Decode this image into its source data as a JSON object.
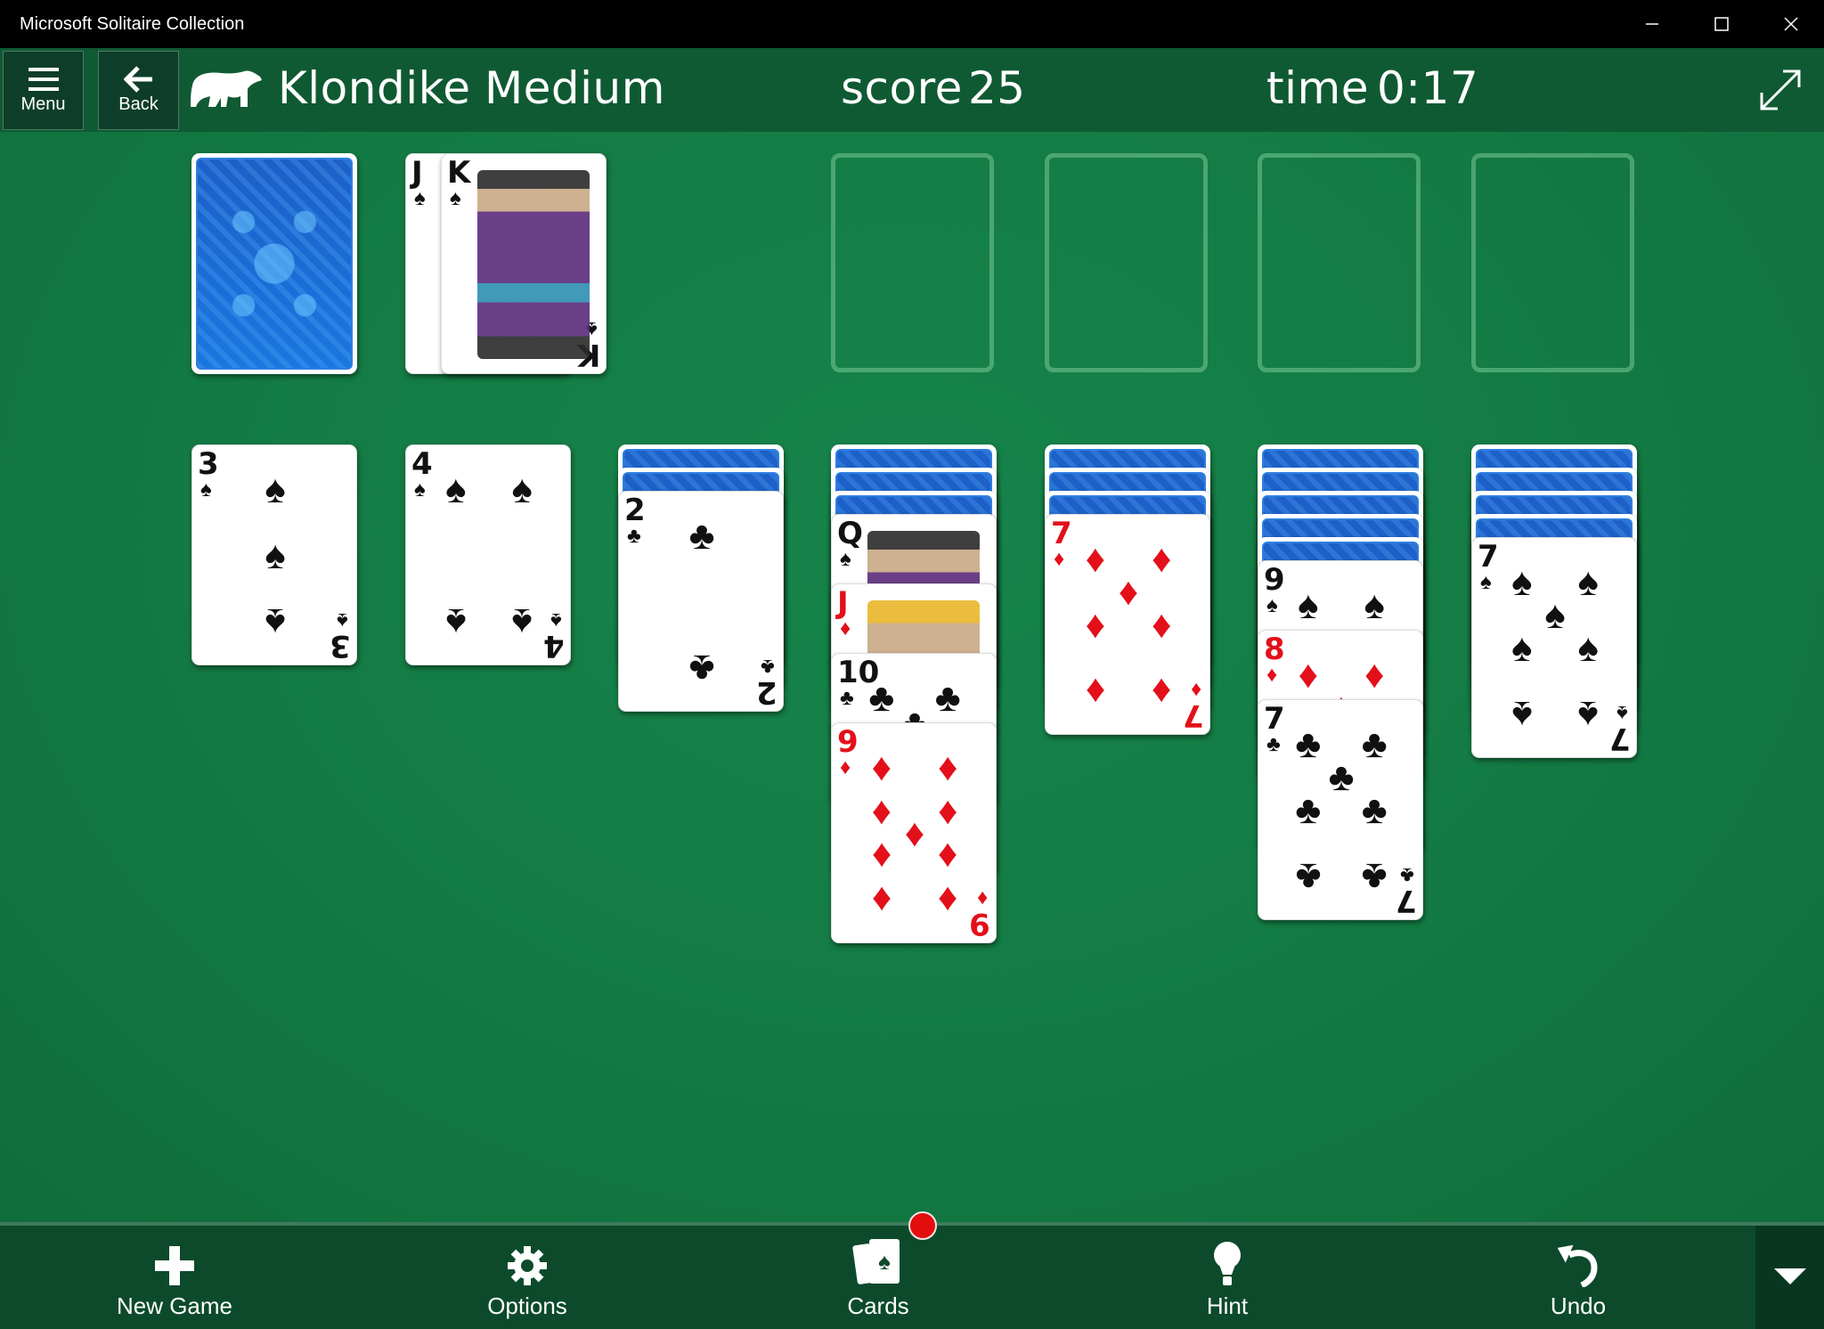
{
  "window": {
    "title": "Microsoft Solitaire Collection",
    "controls": {
      "minimize": "—",
      "maximize": "☐",
      "close": "✕"
    }
  },
  "header": {
    "menu_label": "Menu",
    "back_label": "Back",
    "game_name": "Klondike",
    "difficulty": "Medium",
    "score_label": "score",
    "score_value": "25",
    "time_label": "time",
    "time_value": "0:17"
  },
  "colors": {
    "felt": "#137a43",
    "header": "#0f5a33",
    "bottom_bar": "#0d4a2c",
    "red_suit": "#e3101a",
    "card_back": "#1a77e0",
    "badge": "#e30d0d"
  },
  "stock": {
    "face_down": true
  },
  "waste": [
    {
      "rank": "J",
      "suit": "♠",
      "color": "black"
    },
    {
      "rank": "K",
      "suit": "♠",
      "color": "black"
    }
  ],
  "foundations": [
    {
      "cards": []
    },
    {
      "cards": []
    },
    {
      "cards": []
    },
    {
      "cards": []
    }
  ],
  "tableau": [
    {
      "face_down": 0,
      "face_up": [
        {
          "rank": "3",
          "suit": "♠",
          "color": "black"
        }
      ]
    },
    {
      "face_down": 0,
      "face_up": [
        {
          "rank": "4",
          "suit": "♠",
          "color": "black"
        }
      ]
    },
    {
      "face_down": 2,
      "face_up": [
        {
          "rank": "2",
          "suit": "♣",
          "color": "black"
        }
      ]
    },
    {
      "face_down": 3,
      "face_up": [
        {
          "rank": "Q",
          "suit": "♠",
          "color": "black"
        },
        {
          "rank": "J",
          "suit": "♦",
          "color": "red"
        },
        {
          "rank": "10",
          "suit": "♣",
          "color": "black"
        },
        {
          "rank": "9",
          "suit": "♦",
          "color": "red"
        }
      ]
    },
    {
      "face_down": 3,
      "face_up": [
        {
          "rank": "7",
          "suit": "♦",
          "color": "red"
        }
      ]
    },
    {
      "face_down": 5,
      "face_up": [
        {
          "rank": "9",
          "suit": "♠",
          "color": "black"
        },
        {
          "rank": "8",
          "suit": "♦",
          "color": "red"
        },
        {
          "rank": "7",
          "suit": "♣",
          "color": "black"
        }
      ]
    },
    {
      "face_down": 4,
      "face_up": [
        {
          "rank": "7",
          "suit": "♠",
          "color": "black"
        }
      ]
    }
  ],
  "bottom_bar": {
    "new_game_label": "New Game",
    "options_label": "Options",
    "cards_label": "Cards",
    "cards_has_notification": true,
    "hint_label": "Hint",
    "undo_label": "Undo"
  },
  "icons": {
    "menu": "hamburger-icon",
    "back": "arrow-left-icon",
    "logo": "polar-bear-icon",
    "fullscreen": "expand-diagonal-icon",
    "new_game": "plus-icon",
    "options": "gear-icon",
    "cards": "cards-icon",
    "hint": "lightbulb-icon",
    "undo": "undo-icon",
    "more": "triangle-down-icon"
  }
}
